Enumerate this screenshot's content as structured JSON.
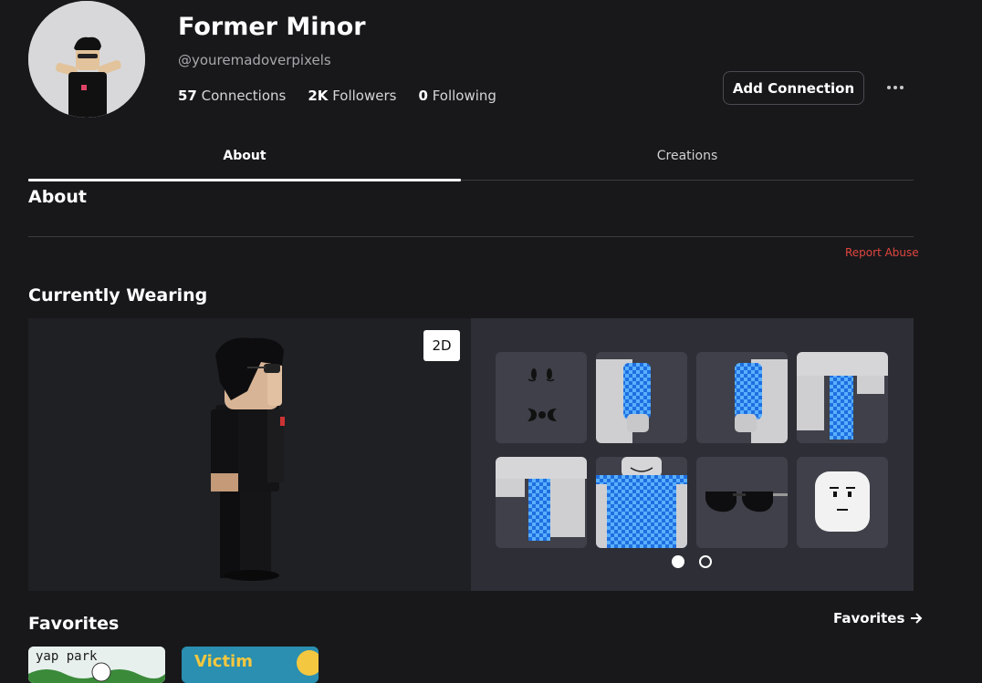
{
  "profile": {
    "display_name": "Former Minor",
    "username": "@youremadoverpixels",
    "connections_count": "57",
    "connections_label": "Connections",
    "followers_count": "2K",
    "followers_label": "Followers",
    "following_count": "0",
    "following_label": "Following"
  },
  "actions": {
    "add_connection": "Add Connection"
  },
  "tabs": [
    {
      "label": "About",
      "active": true
    },
    {
      "label": "Creations",
      "active": false
    }
  ],
  "about": {
    "heading": "About",
    "report_abuse": "Report Abuse"
  },
  "wearing": {
    "heading": "Currently Wearing",
    "toggle_2d": "2D",
    "items": [
      {
        "icon": "face-icon"
      },
      {
        "icon": "left-arm-icon"
      },
      {
        "icon": "right-arm-icon"
      },
      {
        "icon": "left-leg-icon"
      },
      {
        "icon": "right-leg-icon"
      },
      {
        "icon": "torso-icon"
      },
      {
        "icon": "sunglasses-icon"
      },
      {
        "icon": "head-icon"
      }
    ],
    "page": 1,
    "page_count": 2
  },
  "favorites": {
    "heading": "Favorites",
    "link_label": "Favorites",
    "games": [
      {
        "title": "yap park"
      },
      {
        "title": "Victim"
      }
    ]
  },
  "colors": {
    "background": "#18181b",
    "report_abuse": "#e0463e",
    "check_blue": "#2a86f0"
  }
}
